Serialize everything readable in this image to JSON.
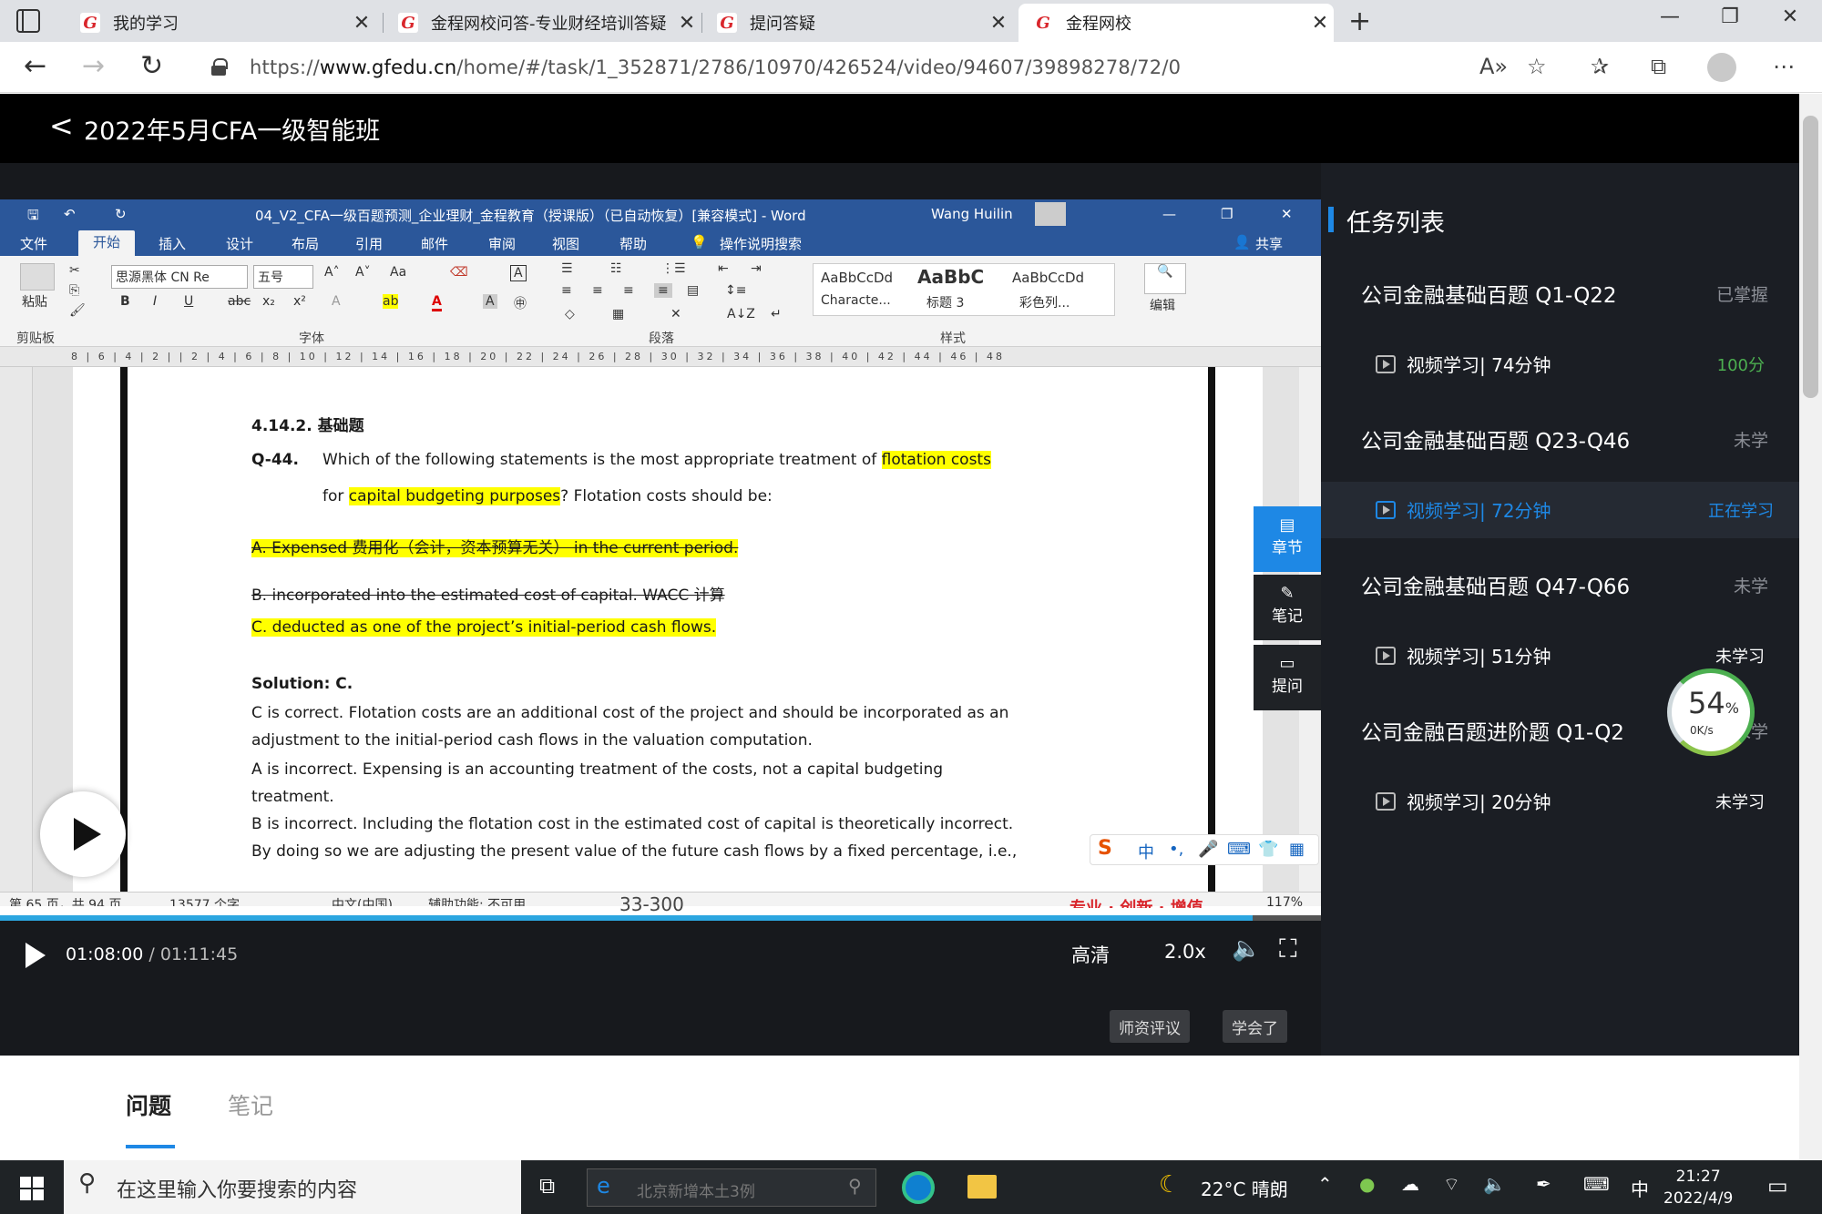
{
  "browser": {
    "tabs": [
      {
        "label": "我的学习",
        "active": false
      },
      {
        "label": "金程网校问答-专业财经培训答疑",
        "active": false
      },
      {
        "label": "提问答疑",
        "active": false
      },
      {
        "label": "金程网校",
        "active": true
      }
    ],
    "favicon_glyph": "G",
    "close_glyph": "✕",
    "new_tab_glyph": "+",
    "url_prefix": "https://",
    "url_host": "www.gfedu.cn",
    "url_path": "/home/#/task/1_352871/2786/10970/426524/video/94607/39898278/72/0",
    "icons": [
      "back-arrow",
      "forward-arrow",
      "refresh",
      "lock",
      "read-aloud",
      "add-favorite",
      "favorites",
      "collections",
      "profile",
      "more"
    ]
  },
  "course": {
    "back_glyph": "<",
    "title": "2022年5月CFA一级智能班"
  },
  "word": {
    "title_bar": "04_V2_CFA一级百题预测_企业理财_金程教育（授课版）（已自动恢复）[兼容模式] - Word",
    "user": "Wang Huilin",
    "menu": [
      "文件",
      "开始",
      "插入",
      "设计",
      "布局",
      "引用",
      "邮件",
      "审阅",
      "视图",
      "帮助",
      "操作说明搜索",
      "共享"
    ],
    "active_menu": "开始",
    "ribbon": {
      "paste": "粘贴",
      "font_name": "思源黑体 CN Re",
      "font_size": "五号",
      "styles": [
        {
          "sample": "AaBbCcDd",
          "name": "Characte..."
        },
        {
          "sample": "AaBbC",
          "name": "标题 3"
        },
        {
          "sample": "AaBbCcDd",
          "name": "彩色列..."
        }
      ],
      "edit": "编辑",
      "groups": [
        "剪贴板",
        "字体",
        "段落",
        "样式"
      ]
    },
    "ruler_marks": "8 | 6 | 4 | 2 |   | 2 | 4 | 6 | 8 | 10 | 12 | 14 | 16 | 18 | 20 | 22 | 24 | 26 | 28 | 30 | 32 | 34 | 36 | 38 | 40 | 42 | 44 | 46 | 48",
    "document": {
      "heading": "4.14.2.   基础题",
      "question_no": "Q-44.",
      "question_line1_a": "Which of the following statements is the most appropriate treatment of ",
      "question_line1_hl": "flotation costs",
      "question_line2_a": "for ",
      "question_line2_hl": "capital budgeting purposes",
      "question_line2_b": "? Flotation costs should be:",
      "option_a": "A.    Expensed 费用化（会计，资本预算无关） in the current period.",
      "option_b": "B.    incorporated into the estimated cost of capital. WACC 计算",
      "option_c": "C.    deducted as one of the project’s initial-period cash flows.",
      "solution": "Solution: C.",
      "sol_lines": [
        "C is correct. Flotation costs are an additional cost of the project and should be incorporated as an",
        "adjustment to the initial-period cash flows in the valuation computation.",
        "A is incorrect. Expensing is an accounting treatment of the costs, not a capital budgeting",
        "treatment.",
        "B is incorrect. Including the flotation cost in the estimated cost of capital is theoretically incorrect.",
        "By doing so we are adjusting the present value of the future cash flows by a fixed percentage, i.e.,"
      ]
    },
    "status_bar": {
      "page": "第 65 页，共 94 页",
      "words": "13577 个字",
      "lang": "中文(中国)",
      "accessibility": "辅助功能: 不可用",
      "zoom": "117%"
    },
    "side_tools": [
      {
        "icon": "chapter-icon",
        "label": "章节",
        "active": true
      },
      {
        "icon": "note-icon",
        "label": "笔记",
        "active": false
      },
      {
        "icon": "question-icon",
        "label": "提问",
        "active": false
      }
    ],
    "ime_items": [
      "S",
      "中",
      "•,",
      "🎤",
      "⌨",
      "👕",
      "▦"
    ]
  },
  "player": {
    "subtitle_overlay": "33-300",
    "watermark": "专业 · 创新 · 增值",
    "current_time": "01:08:00",
    "separator": " / ",
    "duration": "01:11:45",
    "progress": 0.948,
    "quality": "高清",
    "speed": "2.0x",
    "volume_glyph": "🔈",
    "fullscreen_glyph": "⛶",
    "buttons": [
      "师资评议",
      "学会了"
    ]
  },
  "tasks": {
    "heading": "任务列表",
    "chapters": [
      {
        "title": "公司金融基础百题 Q1-Q22",
        "status": "已掌握",
        "lesson": "视频学习| 74分钟",
        "lesson_status": "100分",
        "lesson_color": "#4caf50"
      },
      {
        "title": "公司金融基础百题 Q23-Q46",
        "status": "未学",
        "lesson": "视频学习| 72分钟",
        "lesson_status": "正在学习",
        "lesson_color": "#1e88e5"
      },
      {
        "title": "公司金融基础百题 Q47-Q66",
        "status": "未学",
        "lesson": "视频学习| 51分钟",
        "lesson_status": "未学习",
        "lesson_color": "#ffffff"
      },
      {
        "title": "公司金融百题进阶题 Q1-Q2",
        "status": "未学",
        "lesson": "视频学习| 20分钟",
        "lesson_status": "未学习",
        "lesson_color": "#ffffff"
      }
    ],
    "speed_widget": {
      "percent": "54",
      "unit": "%",
      "rate": "0K/s"
    }
  },
  "qa": {
    "tabs": [
      "问题",
      "笔记"
    ],
    "active": "问题"
  },
  "taskbar": {
    "search_placeholder": "在这里输入你要搜索的内容",
    "ie_placeholder": "北京新增本土3例",
    "weather": "22°C 晴朗",
    "ime": "中",
    "time": "21:27",
    "date": "2022/4/9"
  }
}
